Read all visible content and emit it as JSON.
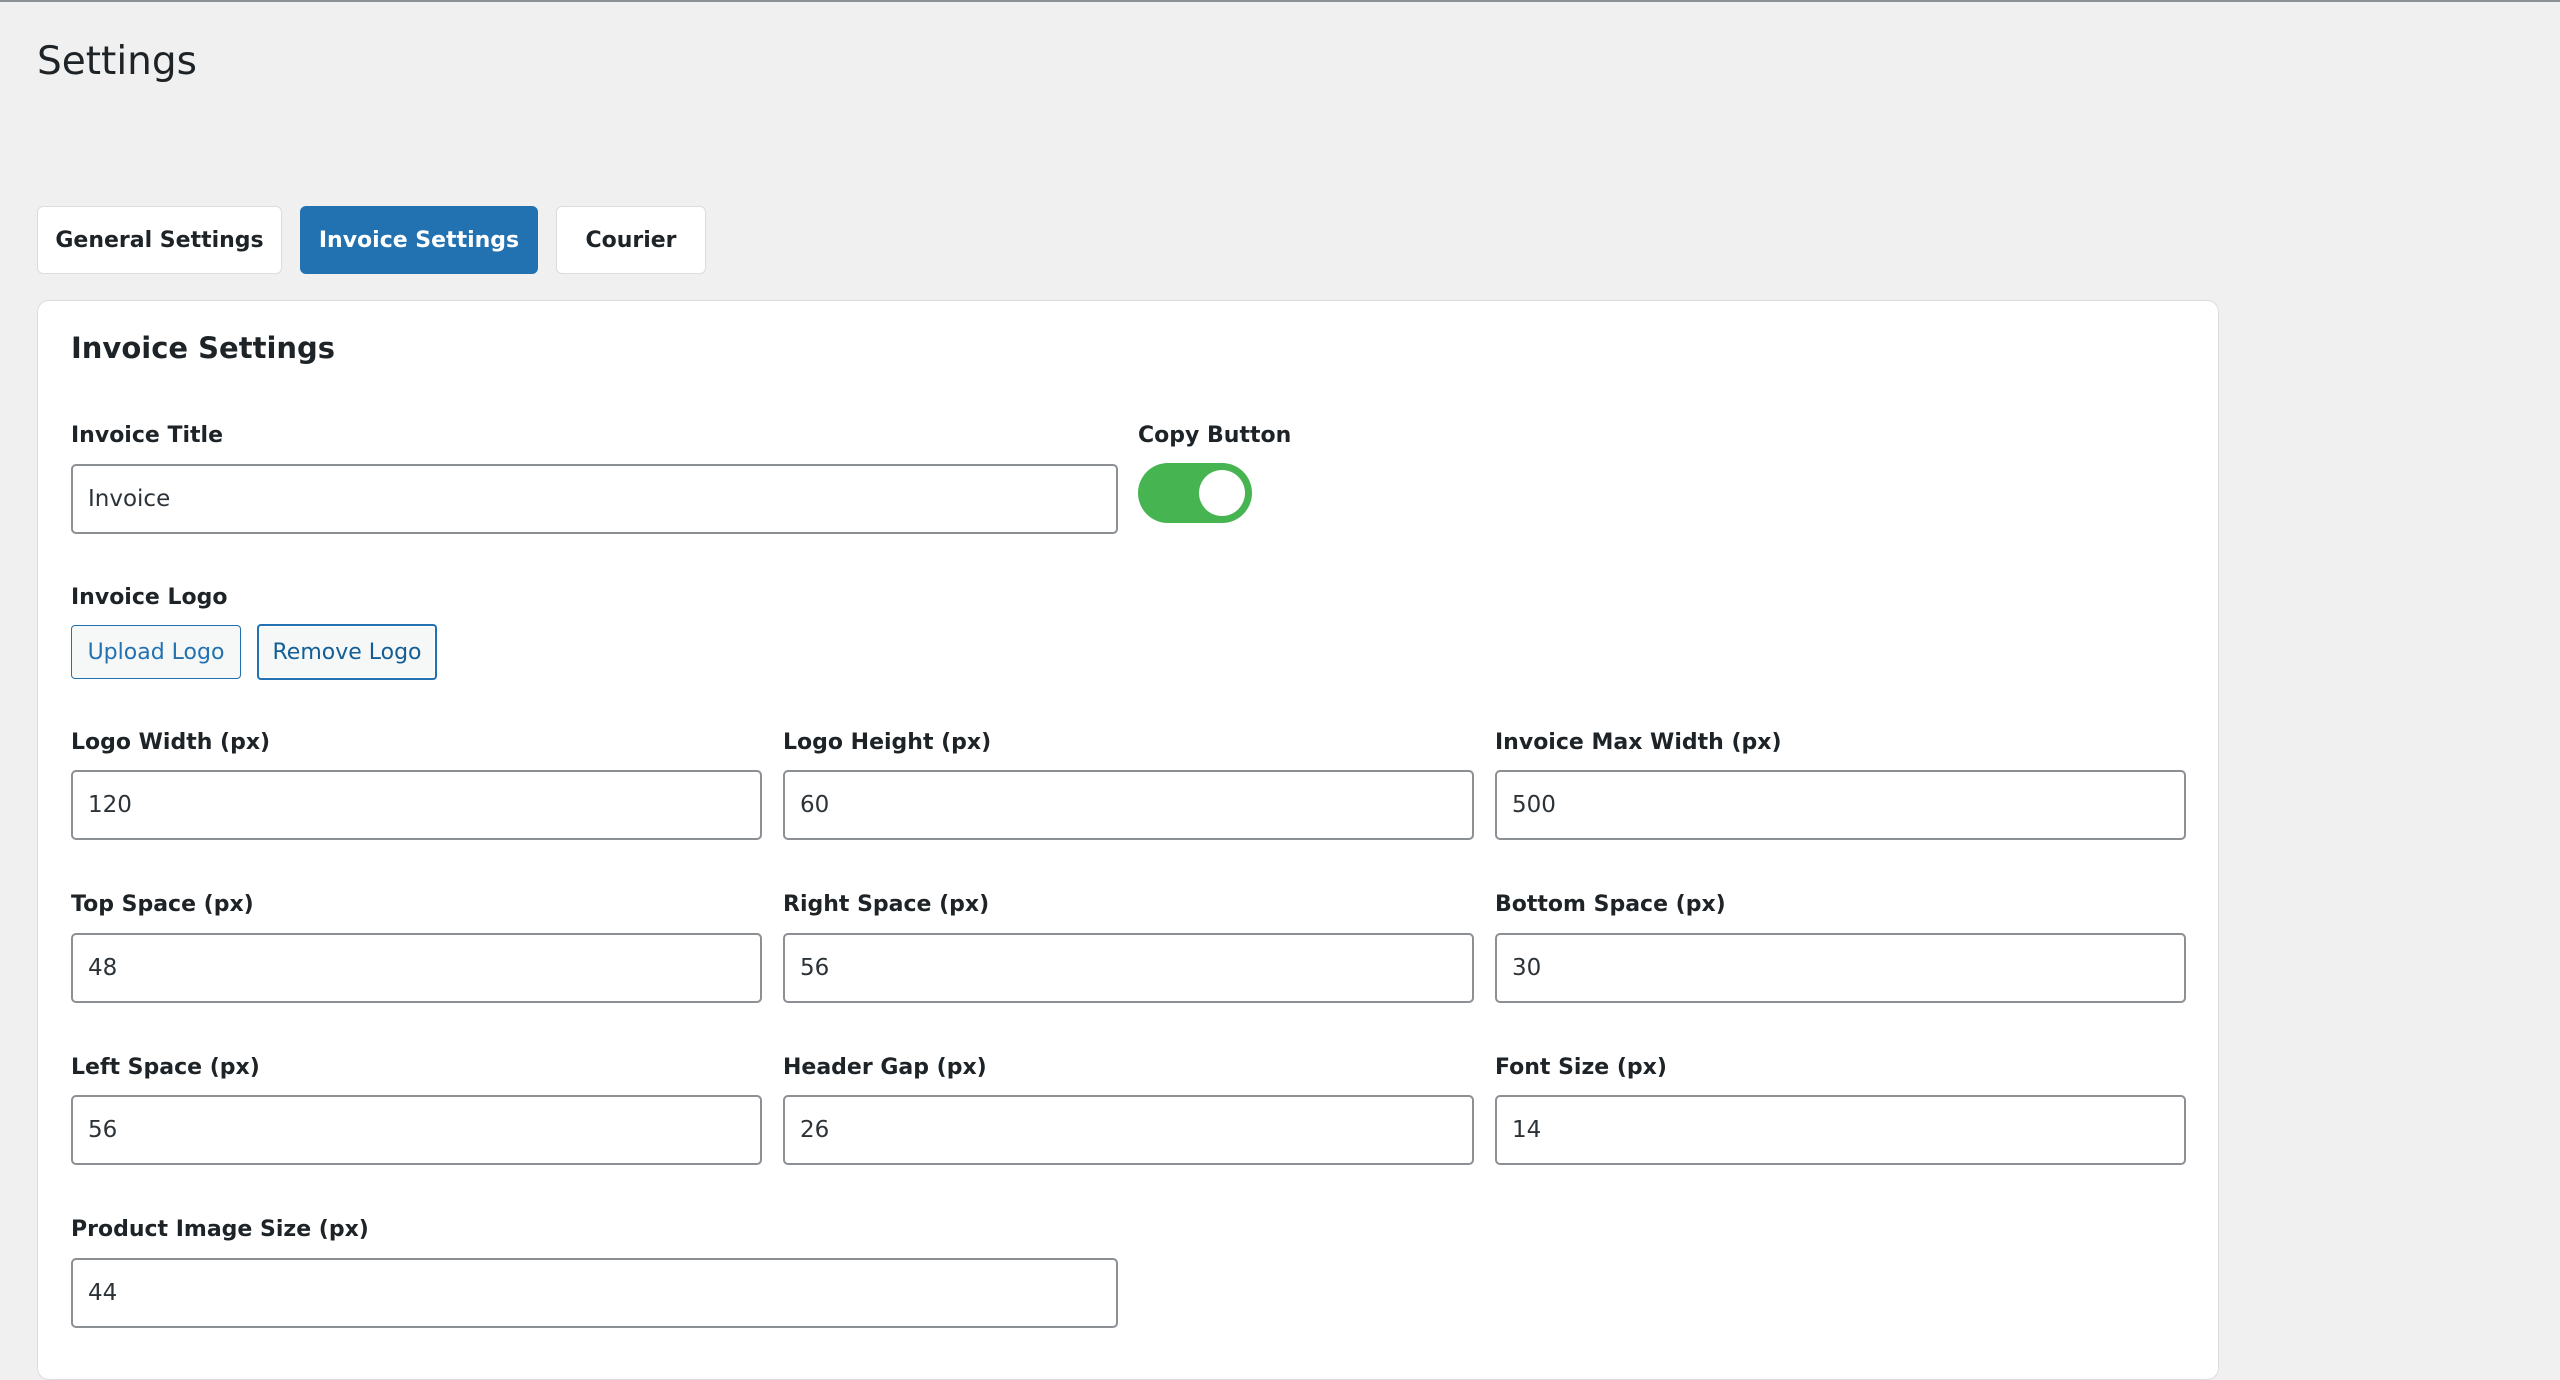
{
  "page": {
    "title": "Settings"
  },
  "tabs": [
    {
      "label": "General Settings",
      "active": false
    },
    {
      "label": "Invoice Settings",
      "active": true
    },
    {
      "label": "Courier",
      "active": false
    }
  ],
  "colors": {
    "accent": "#2271b1",
    "toggle_on": "#46b450"
  },
  "card": {
    "title": "Invoice Settings",
    "invoice_title": {
      "label": "Invoice Title",
      "value": "Invoice"
    },
    "copy_button": {
      "label": "Copy Button",
      "enabled": true
    },
    "invoice_logo": {
      "label": "Invoice Logo",
      "upload_label": "Upload Logo",
      "remove_label": "Remove Logo"
    },
    "fields": {
      "logo_width": {
        "label": "Logo Width (px)",
        "value": "120"
      },
      "logo_height": {
        "label": "Logo Height (px)",
        "value": "60"
      },
      "invoice_max_width": {
        "label": "Invoice Max Width (px)",
        "value": "500"
      },
      "top_space": {
        "label": "Top Space (px)",
        "value": "48"
      },
      "right_space": {
        "label": "Right Space (px)",
        "value": "56"
      },
      "bottom_space": {
        "label": "Bottom Space (px)",
        "value": "30"
      },
      "left_space": {
        "label": "Left Space (px)",
        "value": "56"
      },
      "header_gap": {
        "label": "Header Gap (px)",
        "value": "26"
      },
      "font_size": {
        "label": "Font Size (px)",
        "value": "14"
      },
      "product_image_size": {
        "label": "Product Image Size (px)",
        "value": "44"
      }
    }
  }
}
